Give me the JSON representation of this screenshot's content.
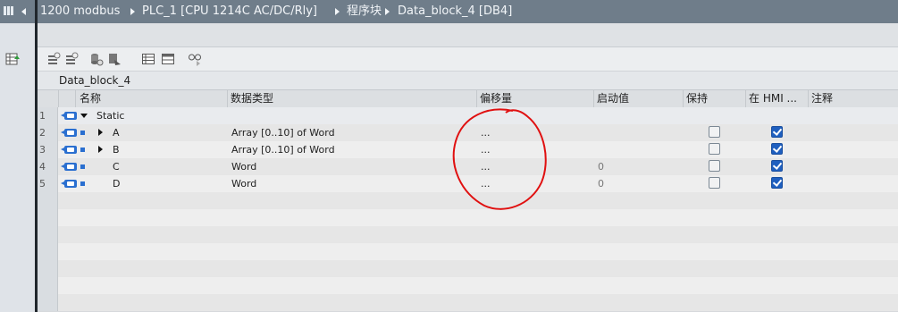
{
  "titlebar": {
    "project": "1200 modbus",
    "device": "PLC_1 [CPU 1214C AC/DC/Rly]",
    "folder": "程序块",
    "block": "Data_block_4 [DB4]"
  },
  "block_title": "Data_block_4",
  "columns": {
    "name": "名称",
    "datatype": "数据类型",
    "offset": "偏移量",
    "start_value": "启动值",
    "retain": "保持",
    "hmi": "在 HMI ...",
    "comment": "注释"
  },
  "rows": [
    {
      "num": "1",
      "name": "Static",
      "datatype": "",
      "offset": "",
      "start_value": "",
      "retain": null,
      "hmi": null
    },
    {
      "num": "2",
      "name": "A",
      "datatype": "Array [0..10] of Word",
      "offset": "...",
      "start_value": "",
      "retain": false,
      "hmi": true
    },
    {
      "num": "3",
      "name": "B",
      "datatype": "Array [0..10] of Word",
      "offset": "...",
      "start_value": "",
      "retain": false,
      "hmi": true
    },
    {
      "num": "4",
      "name": "C",
      "datatype": "Word",
      "offset": "...",
      "start_value": "0",
      "retain": false,
      "hmi": true
    },
    {
      "num": "5",
      "name": "D",
      "datatype": "Word",
      "offset": "...",
      "start_value": "0",
      "retain": false,
      "hmi": true
    }
  ],
  "colors": {
    "titlebar_bg": "#6f7d8a",
    "checkbox_on": "#1f5fbf",
    "annotation_red": "#e01010"
  },
  "icons": [
    "grid-icon",
    "back-arrow-icon",
    "breadcrumb-arrow-icon",
    "dataview-icon",
    "insert-row-icon",
    "add-row-icon",
    "snapshot-icon",
    "copy-snapshot-icon",
    "table-view-icon",
    "column-view-icon",
    "monitor-icon",
    "interface-icon",
    "expand-icon",
    "collapse-icon"
  ]
}
